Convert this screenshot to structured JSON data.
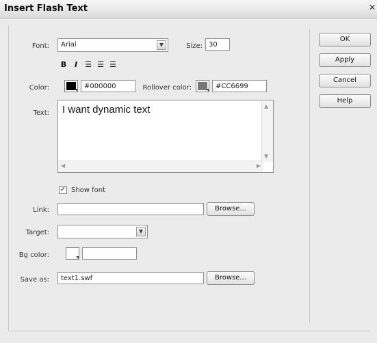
{
  "window": {
    "title": "Insert Flash Text"
  },
  "font": {
    "label": "Font:",
    "value": "Arial"
  },
  "size": {
    "label": "Size:",
    "value": "30"
  },
  "formatting": {
    "bold": "B",
    "italic": "I"
  },
  "color": {
    "label": "Color:",
    "value": "#000000",
    "swatch": "#000000"
  },
  "rollover": {
    "label": "Rollover color:",
    "value": "#CC6699",
    "swatch": "#777777"
  },
  "text": {
    "label": "Text:",
    "value": "I want dynamic text"
  },
  "show_font": {
    "label": "Show font",
    "checked": true
  },
  "link": {
    "label": "Link:",
    "value": "",
    "browse": "Browse..."
  },
  "target": {
    "label": "Target:",
    "value": ""
  },
  "bg_color": {
    "label": "Bg color:",
    "value": ""
  },
  "save_as": {
    "label": "Save as:",
    "value": "text1.swf",
    "browse": "Browse..."
  },
  "buttons": {
    "ok": "OK",
    "apply": "Apply",
    "cancel": "Cancel",
    "help": "Help"
  }
}
